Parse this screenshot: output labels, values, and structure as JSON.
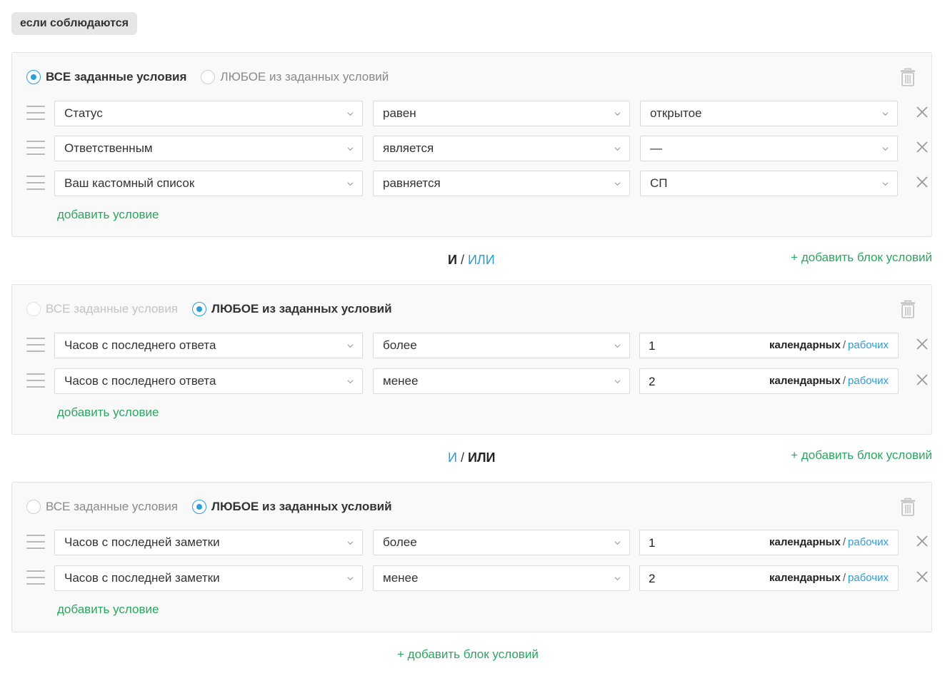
{
  "header": {
    "if_label": "если соблюдаются"
  },
  "blocks": [
    {
      "mode_all": "ВСЕ заданные условия",
      "mode_any": "ЛЮБОЕ из заданных условий",
      "selected": "all",
      "conditions": [
        {
          "field": "Статус",
          "operator": "равен",
          "value": "открытое"
        },
        {
          "field": "Ответственным",
          "operator": "является",
          "value": "—"
        },
        {
          "field": "Ваш кастомный список",
          "operator": "равняется",
          "value": "СП"
        }
      ],
      "add_condition": "добавить условие"
    },
    {
      "mode_all": "ВСЕ заданные условия",
      "mode_any": "ЛЮБОЕ из заданных условий",
      "selected": "any",
      "conditions": [
        {
          "field": "Часов с последнего ответа",
          "operator": "более",
          "number": "1",
          "unit_calendar": "календарных",
          "unit_sep": "/",
          "unit_work": "рабочих"
        },
        {
          "field": "Часов с последнего ответа",
          "operator": "менее",
          "number": "2",
          "unit_calendar": "календарных",
          "unit_sep": "/",
          "unit_work": "рабочих"
        }
      ],
      "add_condition": "добавить условие"
    },
    {
      "mode_all": "ВСЕ заданные условия",
      "mode_any": "ЛЮБОЕ из заданных условий",
      "selected": "any",
      "conditions": [
        {
          "field": "Часов с последней заметки",
          "operator": "более",
          "number": "1",
          "unit_calendar": "календарных",
          "unit_sep": "/",
          "unit_work": "рабочих"
        },
        {
          "field": "Часов с последней заметки",
          "operator": "менее",
          "number": "2",
          "unit_calendar": "календарных",
          "unit_sep": "/",
          "unit_work": "рабочих"
        }
      ],
      "add_condition": "добавить условие"
    }
  ],
  "connectors": [
    {
      "and": "И",
      "sep": "/",
      "or": "ИЛИ",
      "active": "and",
      "add_block": "+ добавить блок условий"
    },
    {
      "and": "И",
      "sep": "/",
      "or": "ИЛИ",
      "active": "or",
      "add_block": "+ добавить блок условий"
    }
  ],
  "footer": {
    "add_block": "+ добавить блок условий"
  },
  "icons": {
    "radio": "radio-icon",
    "trash": "trash-icon",
    "drag": "drag-handle-icon",
    "chevron": "chevron-down-icon",
    "remove": "close-icon"
  },
  "colors": {
    "accent_blue": "#2a9fd8",
    "accent_green": "#2aa660",
    "block_bg": "#f9f9f9",
    "block_border": "#e3e3e3",
    "badge_bg": "#e6e6e6"
  }
}
